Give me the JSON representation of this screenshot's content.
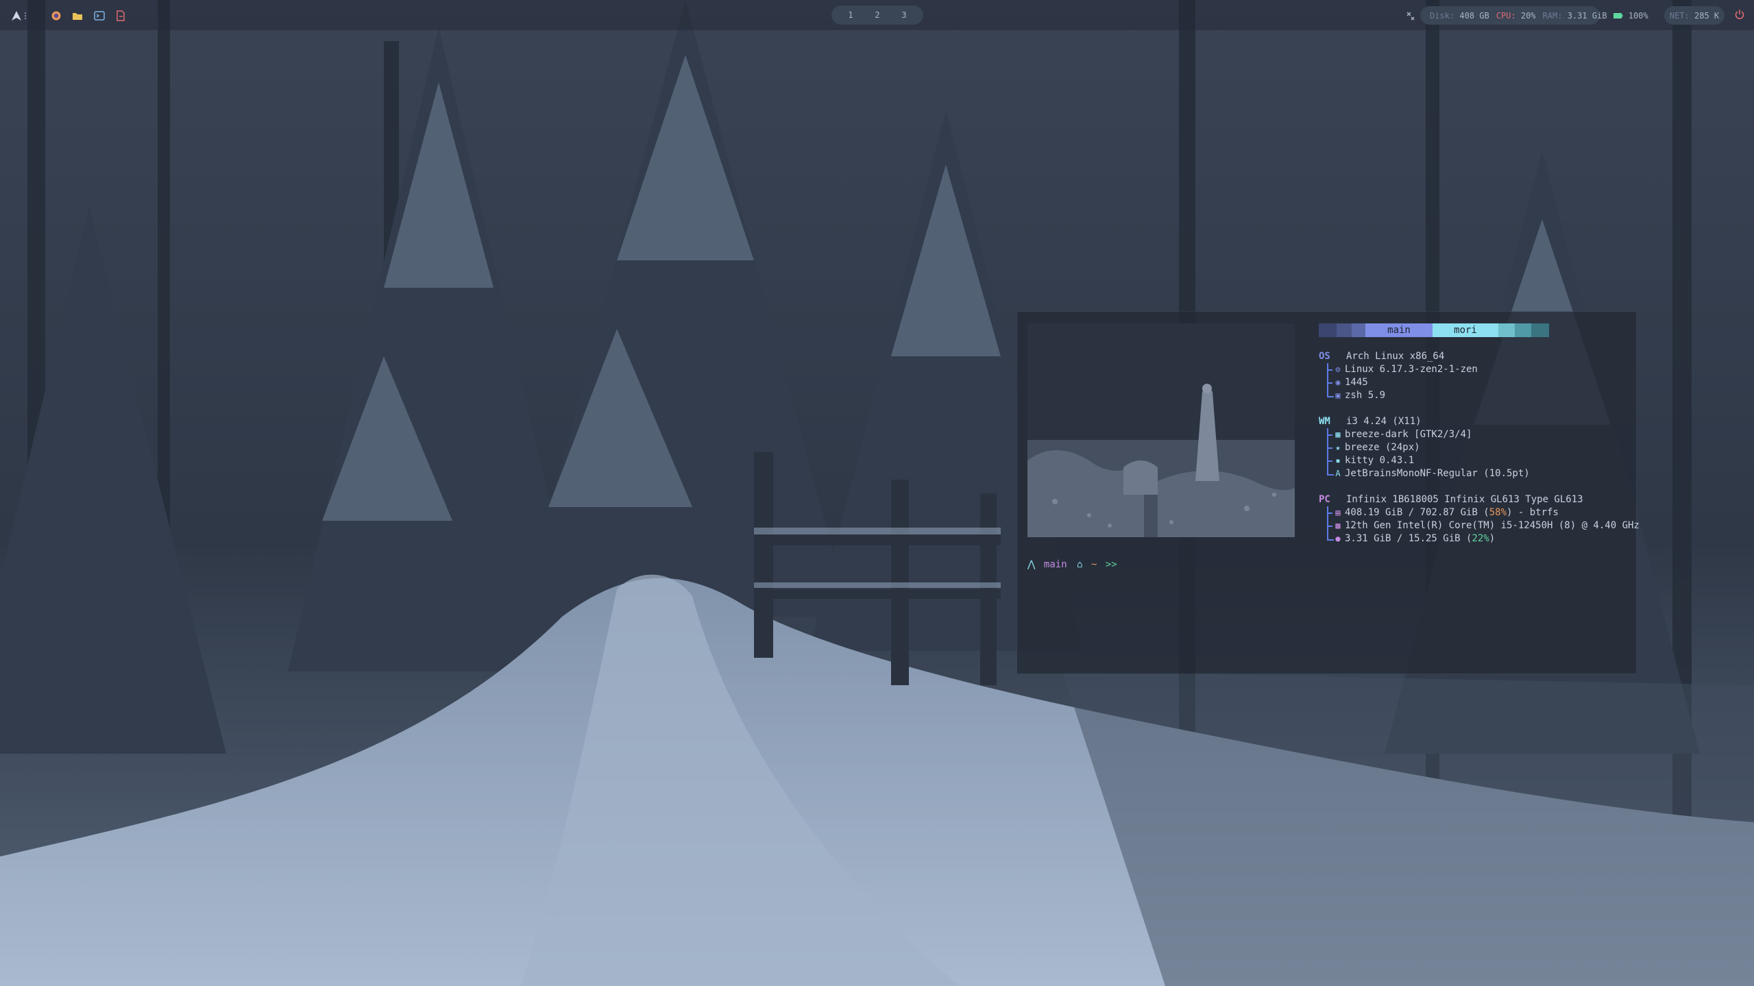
{
  "topbar": {
    "workspaces": [
      "1",
      "2",
      "3"
    ],
    "sysinfo": {
      "disk_label": "Disk:",
      "disk_value": "408 GB",
      "cpu_label": "CPU:",
      "cpu_value": "20%",
      "ram_label": "RAM:",
      "ram_value": "3.31 GiB",
      "battery_value": "100%"
    },
    "net": {
      "label": "NET:",
      "value": "285 K"
    }
  },
  "fastfetch": {
    "tabs": {
      "main": "main",
      "mori": "mori"
    },
    "os": {
      "key": "OS",
      "value": "Arch Linux x86_64",
      "rows": [
        "Linux 6.17.3-zen2-1-zen",
        "1445",
        "zsh 5.9"
      ]
    },
    "wm": {
      "key": "WM",
      "value": "i3 4.24 (X11)",
      "rows": [
        "breeze-dark [GTK2/3/4]",
        "breeze (24px)",
        "kitty 0.43.1",
        "JetBrainsMonoNF-Regular (10.5pt)"
      ]
    },
    "pc": {
      "key": "PC",
      "value": "Infinix 1B618005 Infinix GL613 Type GL613",
      "disk": {
        "pre": "408.19 GiB / 702.87 GiB (",
        "pct": "58%",
        "post": ") - btrfs"
      },
      "cpu": "12th Gen Intel(R) Core(TM) i5-12450H (8) @ 4.40 GHz",
      "mem": {
        "pre": "3.31 GiB / 15.25 GiB (",
        "pct": "22%",
        "post": ")"
      }
    }
  },
  "prompt": {
    "branch": "main",
    "dir": "~",
    "arrows": ">>"
  },
  "colors": {
    "accent": "#7f8ee6",
    "cyan": "#8de0f0",
    "os_key": "#7f8ee6",
    "wm_key": "#8de0f0",
    "pc_key": "#c58be0",
    "warn": "#e8965a",
    "ok": "#5fd7a0"
  }
}
